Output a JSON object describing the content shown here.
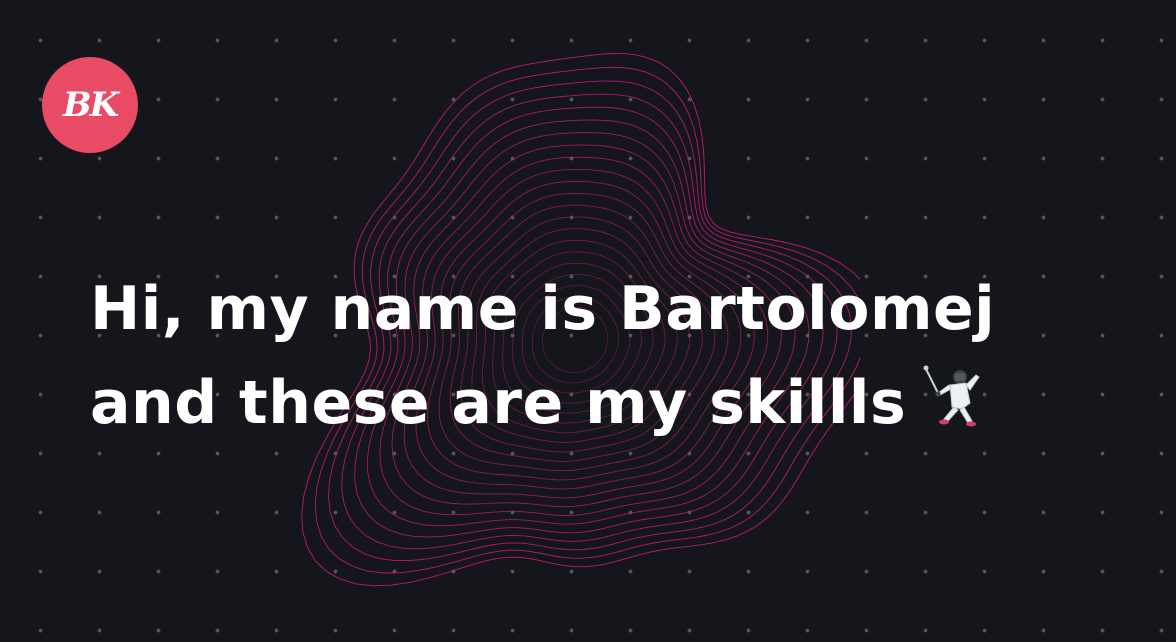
{
  "theme": {
    "background": "#14161b",
    "accent": "#e94a64",
    "wave_color": "#d11a7c",
    "text_color": "#ffffff"
  },
  "logo": {
    "initials": "BK"
  },
  "headline": {
    "line1": "Hi, my name is Bartolomej",
    "line2": "and these are my skillls",
    "emoji_icon": "fencer-icon"
  }
}
